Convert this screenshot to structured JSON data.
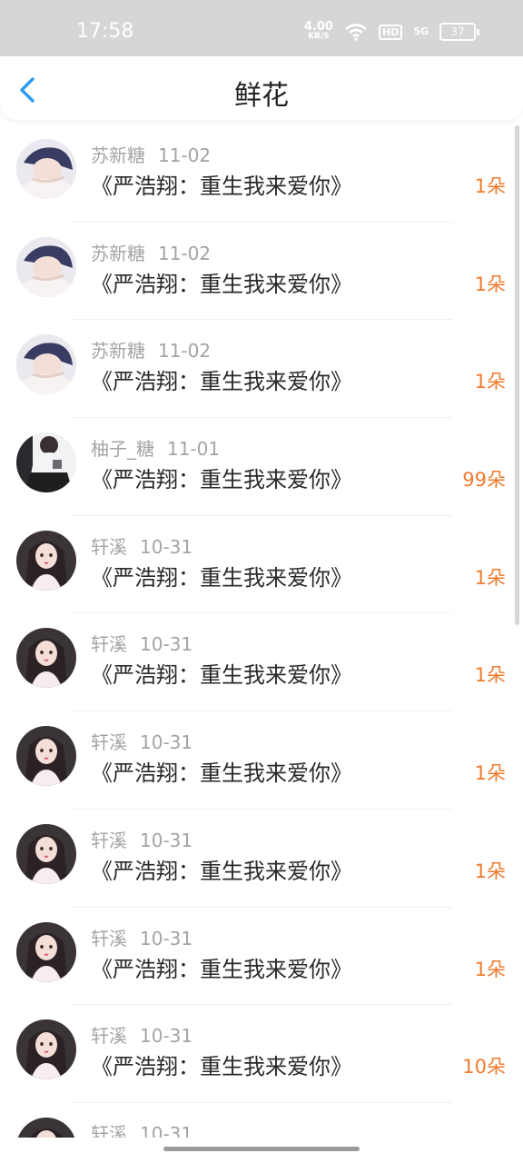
{
  "status_bar": {
    "time": "17:58",
    "net_speed": "4.00",
    "net_unit": "KB/S",
    "hd": "HD",
    "signal": "5G",
    "battery": "37"
  },
  "header": {
    "title": "鲜花"
  },
  "colors": {
    "accent": "#2f9bf0",
    "amount": "#f07b2e",
    "meta": "#a4a4a4"
  },
  "records": [
    {
      "user": "苏新糖",
      "date": "11-02",
      "book": "《严浩翔：重生我来爱你》",
      "amount": "1朵",
      "avatar": "boy"
    },
    {
      "user": "苏新糖",
      "date": "11-02",
      "book": "《严浩翔：重生我来爱你》",
      "amount": "1朵",
      "avatar": "boy"
    },
    {
      "user": "苏新糖",
      "date": "11-02",
      "book": "《严浩翔：重生我来爱你》",
      "amount": "1朵",
      "avatar": "boy"
    },
    {
      "user": "柚子_糖",
      "date": "11-01",
      "book": "《严浩翔：重生我来爱你》",
      "amount": "99朵",
      "avatar": "photo"
    },
    {
      "user": "轩溪",
      "date": "10-31",
      "book": "《严浩翔：重生我来爱你》",
      "amount": "1朵",
      "avatar": "girl"
    },
    {
      "user": "轩溪",
      "date": "10-31",
      "book": "《严浩翔：重生我来爱你》",
      "amount": "1朵",
      "avatar": "girl"
    },
    {
      "user": "轩溪",
      "date": "10-31",
      "book": "《严浩翔：重生我来爱你》",
      "amount": "1朵",
      "avatar": "girl"
    },
    {
      "user": "轩溪",
      "date": "10-31",
      "book": "《严浩翔：重生我来爱你》",
      "amount": "1朵",
      "avatar": "girl"
    },
    {
      "user": "轩溪",
      "date": "10-31",
      "book": "《严浩翔：重生我来爱你》",
      "amount": "1朵",
      "avatar": "girl"
    },
    {
      "user": "轩溪",
      "date": "10-31",
      "book": "《严浩翔：重生我来爱你》",
      "amount": "10朵",
      "avatar": "girl"
    },
    {
      "user": "轩溪",
      "date": "10-31",
      "book": "",
      "amount": "",
      "avatar": "girl"
    }
  ]
}
